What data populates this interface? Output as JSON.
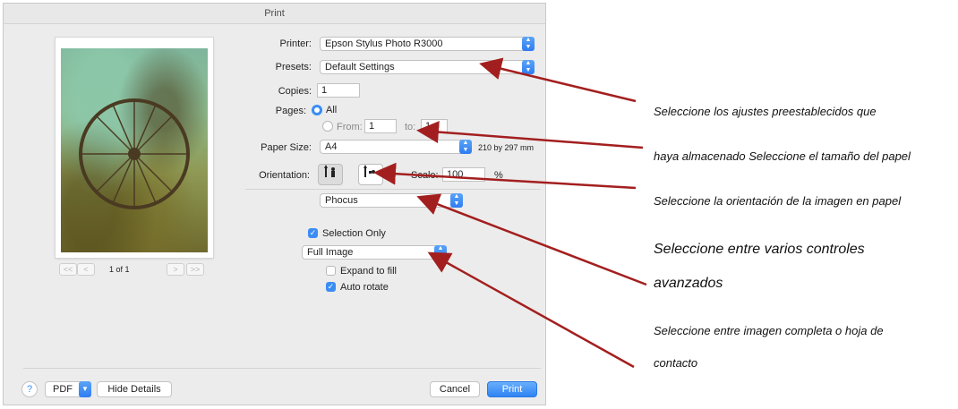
{
  "dialog": {
    "title": "Print",
    "printer": {
      "label": "Printer:",
      "value": "Epson Stylus Photo R3000"
    },
    "presets": {
      "label": "Presets:",
      "value": "Default Settings"
    },
    "copies": {
      "label": "Copies:",
      "value": "1"
    },
    "pages": {
      "label": "Pages:",
      "all_label": "All",
      "from_label": "From:",
      "from_value": "1",
      "to_label": "to:",
      "to_value": "1"
    },
    "paper_size": {
      "label": "Paper Size:",
      "value": "A4",
      "dimensions": "210 by 297 mm"
    },
    "orientation": {
      "label": "Orientation:",
      "portrait_icon": "portrait-icon",
      "landscape_icon": "landscape-icon"
    },
    "scale": {
      "label": "Scale:",
      "value": "100",
      "unit": "%"
    },
    "section_popup": "Phocus",
    "selection_only": {
      "label": "Selection Only",
      "checked": true
    },
    "image_mode": "Full Image",
    "expand_to_fill": {
      "label": "Expand to fill",
      "checked": false
    },
    "auto_rotate": {
      "label": "Auto rotate",
      "checked": true
    },
    "preview_nav": {
      "first": "<<",
      "prev": "<",
      "page_indicator": "1 of 1",
      "next": ">",
      "last": ">>"
    },
    "footer": {
      "help": "?",
      "pdf": "PDF",
      "hide_details": "Hide Details",
      "cancel": "Cancel",
      "print": "Print"
    }
  },
  "annotations": [
    "Seleccione los ajustes preestablecidos que",
    "haya almacenado Seleccione el tamaño del papel",
    "Seleccione la orientación de la imagen en papel",
    "Seleccione entre varios controles",
    "avanzados",
    "Seleccione entre imagen completa o hoja de",
    "contacto"
  ],
  "colors": {
    "accent": "#3b8df4",
    "arrow": "#a31f1f"
  }
}
